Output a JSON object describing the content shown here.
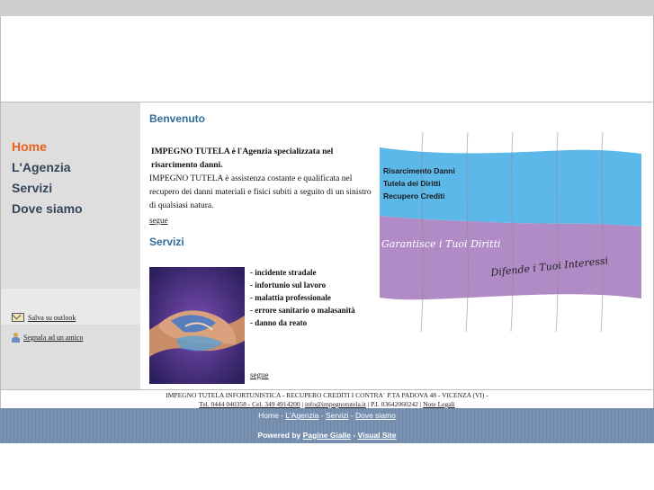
{
  "sidebar": {
    "nav": [
      "Home",
      "L'Agenzia",
      "Servizi",
      "Dove siamo"
    ],
    "tools": [
      {
        "label": "Salva su outlook",
        "icon": "envelope-icon"
      },
      {
        "label": "Segnala ad un amico",
        "icon": "friend-icon"
      }
    ]
  },
  "welcome": {
    "title": "Benvenuto",
    "lead1": "IMPEGNO TUTELA è l'Agenzia specializzata nel",
    "lead2": "risarcimento danni.",
    "body": "IMPEGNO TUTELA è assistenza costante e qualificata nel recupero dei danni materiali e fisici subiti a seguito di un sinistro di qualsiasi natura.",
    "more": "segue"
  },
  "services": {
    "title": "Servizi",
    "items": [
      "- incidente stradale",
      "- infortunio sul lavoro",
      "- malattia professionale",
      "- errore sanitario o malasanità",
      "- danno da reato"
    ],
    "more": "segue"
  },
  "banner": {
    "lines": [
      "Risarcimento Danni",
      "Tutela dei Diritti",
      "Recupero Crediti"
    ],
    "script1": "Garantisce i Tuoi   Diritti",
    "script2": "Difende i Tuoi  Interessi"
  },
  "footer": {
    "line1": "IMPEGNO TUTELA INFORTUNISTICA - RECUPERO CREDITI I CONTRA` P.TA PADOVA 48 - VICENZA (VI) -",
    "phones": "Tel. 0444 040358 - Cel. 349 4914200",
    "email": "info@impegnotutela.it",
    "piva": "P.I. 03642060242",
    "legal": "Note Legali"
  },
  "bottom": {
    "links": [
      "Home",
      "L'Agenzia",
      "Servizi",
      "Dove siamo"
    ],
    "powered_prefix": "Powered by",
    "powered_link1": "Pagine Gialle",
    "powered_link2": "Visual Site"
  },
  "colors": {
    "accent": "#e8621d",
    "nav": "#34455a",
    "heading": "#2f6d9c",
    "banner_blue": "#5bb8e8",
    "banner_purple": "#b18bc6",
    "footer_bar": "#7891b1"
  }
}
